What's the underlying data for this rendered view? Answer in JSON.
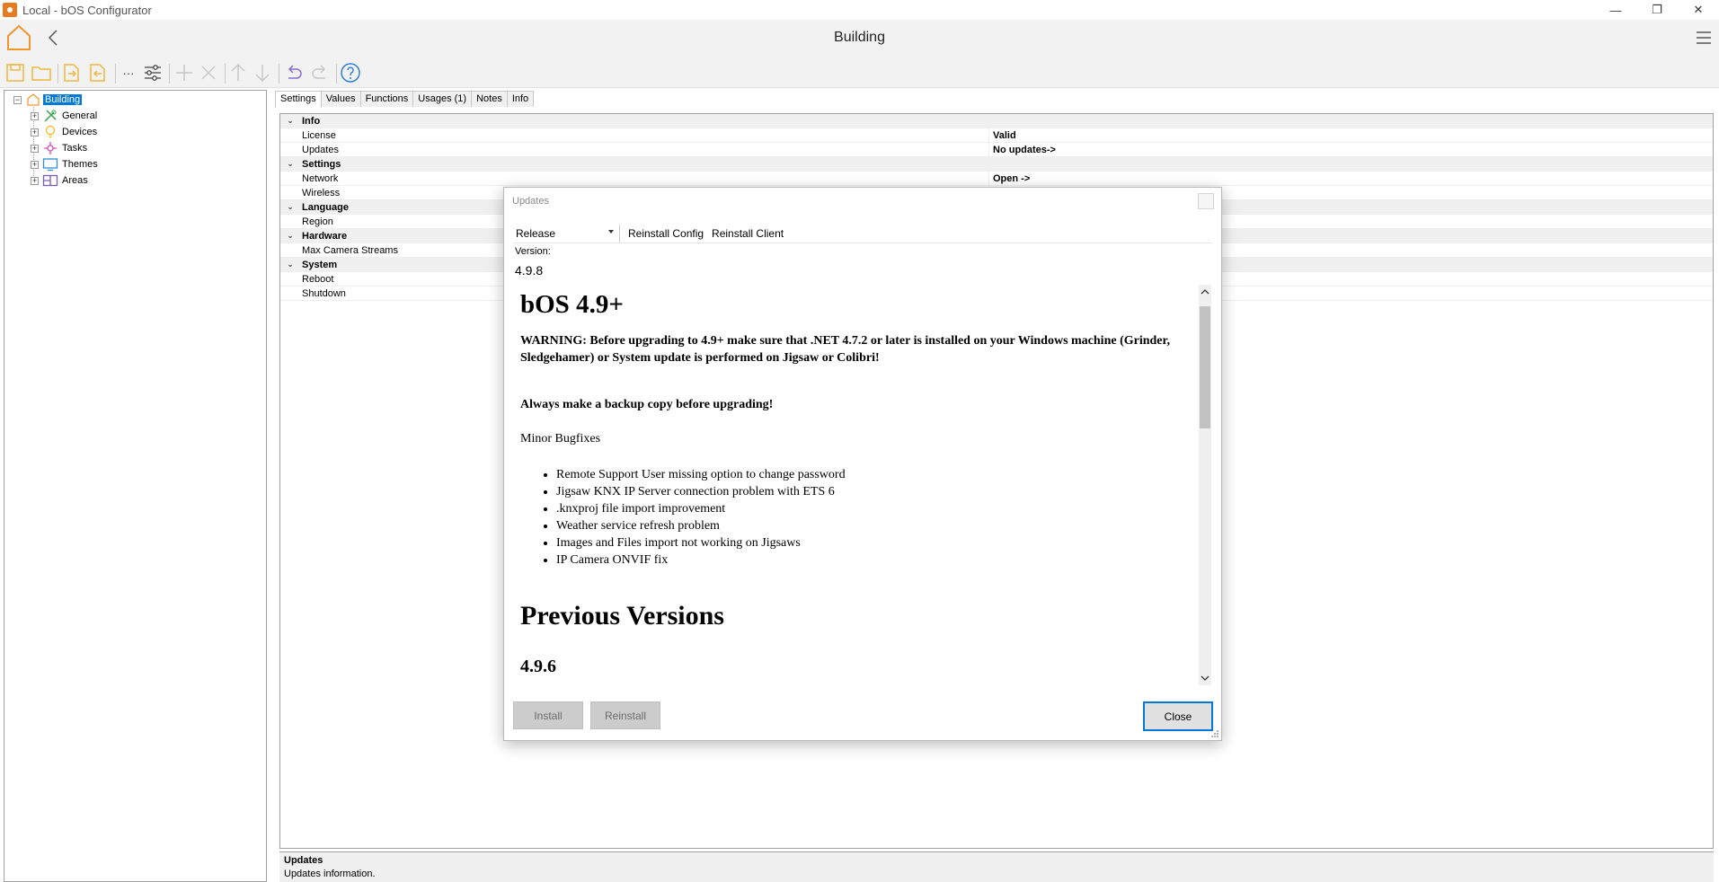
{
  "window": {
    "title": "Local - bOS Configurator",
    "minimize": "—",
    "restore": "❐",
    "close": "✕"
  },
  "header": {
    "title": "Building"
  },
  "toolbar": {
    "more_label": "···"
  },
  "tree": {
    "root": "Building",
    "items": [
      {
        "label": "General"
      },
      {
        "label": "Devices"
      },
      {
        "label": "Tasks"
      },
      {
        "label": "Themes"
      },
      {
        "label": "Areas"
      }
    ]
  },
  "tabs": [
    {
      "label": "Settings"
    },
    {
      "label": "Values"
    },
    {
      "label": "Functions"
    },
    {
      "label": "Usages (1)"
    },
    {
      "label": "Notes"
    },
    {
      "label": "Info"
    }
  ],
  "grid": {
    "rows": [
      {
        "type": "cat",
        "label": "Info"
      },
      {
        "type": "prop",
        "label": "License",
        "value": "Valid"
      },
      {
        "type": "prop",
        "label": "Updates",
        "value": "No updates->"
      },
      {
        "type": "cat",
        "label": "Settings"
      },
      {
        "type": "prop",
        "label": "Network",
        "value": "Open ->"
      },
      {
        "type": "prop",
        "label": "Wireless",
        "value": ""
      },
      {
        "type": "cat",
        "label": "Language"
      },
      {
        "type": "prop",
        "label": "Region",
        "value": ""
      },
      {
        "type": "cat",
        "label": "Hardware"
      },
      {
        "type": "prop",
        "label": "Max Camera Streams",
        "value": ""
      },
      {
        "type": "cat",
        "label": "System"
      },
      {
        "type": "prop",
        "label": "Reboot",
        "value": ""
      },
      {
        "type": "prop",
        "label": "Shutdown",
        "value": ""
      }
    ]
  },
  "status": {
    "title": "Updates",
    "description": "Updates information."
  },
  "dialog": {
    "title": "Updates",
    "channel": "Release",
    "reinstall_config": "Reinstall Config",
    "reinstall_client": "Reinstall Client",
    "version_label": "Version:",
    "version_value": "4.9.8",
    "notes": {
      "heading": "bOS 4.9+",
      "warning": "WARNING: Before upgrading to 4.9+ make sure that .NET 4.7.2 or later is installed on your Windows machine (Grinder, Sledgehamer) or System update is performed on Jigsaw or Colibri!",
      "backup": "Always make a backup copy before upgrading!",
      "minor": "Minor Bugfixes",
      "bullets": [
        "Remote Support User missing option to change password",
        "Jigsaw KNX IP Server connection problem with ETS 6",
        ".knxproj file import improvement",
        "Weather service refresh problem",
        "Images and Files import not working on Jigsaws",
        "IP Camera ONVIF fix"
      ],
      "previous_heading": "Previous Versions",
      "previous_version": "4.9.6"
    },
    "install_label": "Install",
    "reinstall_label": "Reinstall",
    "close_label": "Close"
  }
}
